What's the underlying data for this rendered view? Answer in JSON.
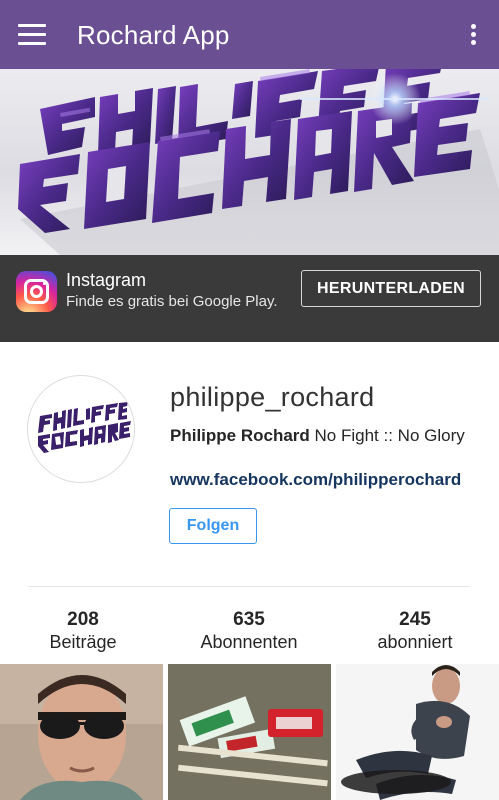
{
  "app_bar": {
    "title": "Rochard App",
    "menu_icon": "hamburger-menu-icon",
    "overflow_icon": "more-vertical-icon",
    "color": "#6a4f93"
  },
  "banner": {
    "description_icon": "philippe-rochard-logo-banner"
  },
  "ad": {
    "app_name": "Instagram",
    "subtitle": "Finde es gratis bei Google Play.",
    "button_label": "HERUNTERLADEN",
    "icon": "instagram-icon"
  },
  "profile": {
    "username": "philippe_rochard",
    "display_name": "Philippe Rochard",
    "bio_text": " No Fight :: No Glory",
    "website": "www.facebook.com/philipperochard",
    "follow_label": "Folgen",
    "accent_color": "#3897f0"
  },
  "stats": [
    {
      "value": "208",
      "label": "Beiträge"
    },
    {
      "value": "635",
      "label": "Abonnenten"
    },
    {
      "value": "245",
      "label": "abonniert"
    }
  ],
  "photos": [
    {
      "icon": "portrait-sunglasses-photo"
    },
    {
      "icon": "kitkat-snacks-photo"
    },
    {
      "icon": "man-in-chair-photo"
    }
  ]
}
